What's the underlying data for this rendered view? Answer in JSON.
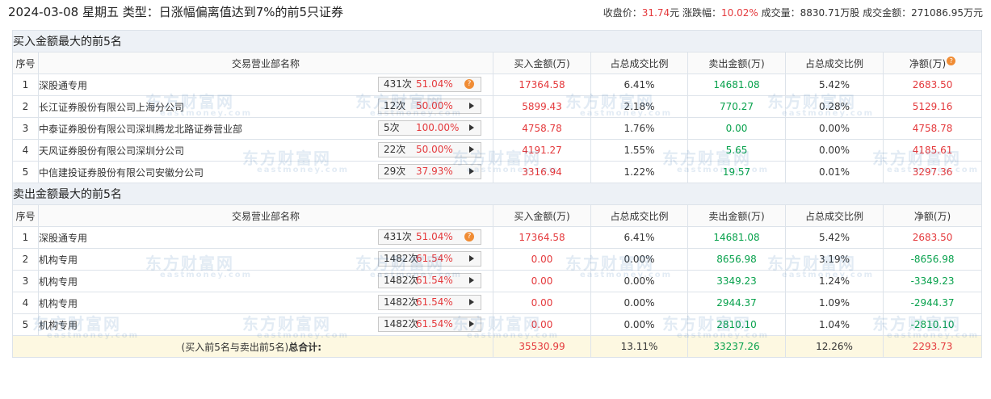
{
  "header": {
    "title": "2024-03-08 星期五 类型：日涨幅偏离值达到7%的前5只证券",
    "close_label": "收盘价：",
    "close_value": "31.74",
    "close_unit": "元",
    "change_label": "涨跌幅：",
    "change_value": "10.02%",
    "volume_label": "成交量：",
    "volume_value": "8830.71万股",
    "turnover_label": "成交金额：",
    "turnover_value": "271086.95万元"
  },
  "columns": [
    "序号",
    "交易营业部名称",
    "买入金额(万)",
    "占总成交比例",
    "卖出金额(万)",
    "占总成交比例",
    "净额(万)"
  ],
  "buy_section": {
    "title": "买入金额最大的前5名",
    "rows": [
      {
        "no": "1",
        "name": "深股通专用",
        "times": "431次",
        "pct": "51.04%",
        "buy": "17364.58",
        "buy_ratio": "6.41%",
        "sell": "14681.08",
        "sell_ratio": "5.42%",
        "net": "2683.50"
      },
      {
        "no": "2",
        "name": "长江证券股份有限公司上海分公司",
        "times": "12次",
        "pct": "50.00%",
        "buy": "5899.43",
        "buy_ratio": "2.18%",
        "sell": "770.27",
        "sell_ratio": "0.28%",
        "net": "5129.16"
      },
      {
        "no": "3",
        "name": "中泰证券股份有限公司深圳腾龙北路证券营业部",
        "times": "5次",
        "pct": "100.00%",
        "buy": "4758.78",
        "buy_ratio": "1.76%",
        "sell": "0.00",
        "sell_ratio": "0.00%",
        "net": "4758.78"
      },
      {
        "no": "4",
        "name": "天风证券股份有限公司深圳分公司",
        "times": "22次",
        "pct": "50.00%",
        "buy": "4191.27",
        "buy_ratio": "1.55%",
        "sell": "5.65",
        "sell_ratio": "0.00%",
        "net": "4185.61"
      },
      {
        "no": "5",
        "name": "中信建投证券股份有限公司安徽分公司",
        "times": "29次",
        "pct": "37.93%",
        "buy": "3316.94",
        "buy_ratio": "1.22%",
        "sell": "19.57",
        "sell_ratio": "0.01%",
        "net": "3297.36"
      }
    ]
  },
  "sell_section": {
    "title": "卖出金额最大的前5名",
    "rows": [
      {
        "no": "1",
        "name": "深股通专用",
        "times": "431次",
        "pct": "51.04%",
        "buy": "17364.58",
        "buy_ratio": "6.41%",
        "sell": "14681.08",
        "sell_ratio": "5.42%",
        "net": "2683.50"
      },
      {
        "no": "2",
        "name": "机构专用",
        "times": "1482次",
        "pct": "61.54%",
        "buy": "0.00",
        "buy_ratio": "0.00%",
        "sell": "8656.98",
        "sell_ratio": "3.19%",
        "net": "-8656.98"
      },
      {
        "no": "3",
        "name": "机构专用",
        "times": "1482次",
        "pct": "61.54%",
        "buy": "0.00",
        "buy_ratio": "0.00%",
        "sell": "3349.23",
        "sell_ratio": "1.24%",
        "net": "-3349.23"
      },
      {
        "no": "4",
        "name": "机构专用",
        "times": "1482次",
        "pct": "61.54%",
        "buy": "0.00",
        "buy_ratio": "0.00%",
        "sell": "2944.37",
        "sell_ratio": "1.09%",
        "net": "-2944.37"
      },
      {
        "no": "5",
        "name": "机构专用",
        "times": "1482次",
        "pct": "61.54%",
        "buy": "0.00",
        "buy_ratio": "0.00%",
        "sell": "2810.10",
        "sell_ratio": "1.04%",
        "net": "-2810.10"
      }
    ]
  },
  "total": {
    "label_prefix": "(买入前5名与卖出前5名)",
    "label_bold": "总合计:",
    "buy": "35530.99",
    "buy_ratio": "13.11%",
    "sell": "33237.26",
    "sell_ratio": "12.26%",
    "net": "2293.73"
  },
  "watermark": {
    "cn": "东方财富网",
    "en": "eastmoney.com"
  },
  "help_icon": "question-mark-icon",
  "colors": {
    "red": "#e4393c",
    "green": "#07a14c",
    "orange": "#f08c34",
    "section_bg": "#edf1f6",
    "total_bg": "#fdf8e1"
  }
}
